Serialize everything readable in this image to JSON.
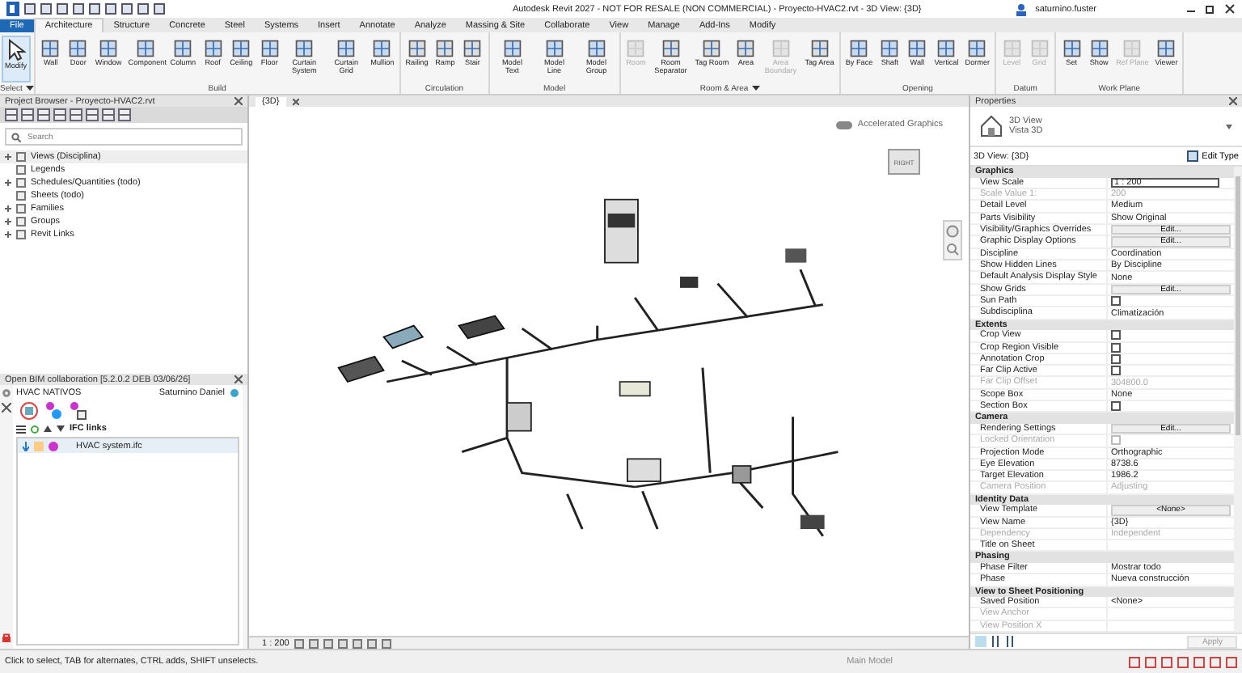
{
  "title_bar": {
    "title": "Autodesk Revit 2027 - NOT FOR RESALE (NON COMMERCIAL) - Proyecto-HVAC2.rvt - 3D View: {3D}",
    "user": "saturnino.fuster"
  },
  "ribbon_tabs": [
    {
      "label": "File",
      "kind": "file",
      "selected": false
    },
    {
      "label": "Architecture",
      "kind": "tab",
      "selected": true
    },
    {
      "label": "Structure",
      "kind": "tab",
      "selected": false
    },
    {
      "label": "Concrete",
      "kind": "tab",
      "selected": false
    },
    {
      "label": "Steel",
      "kind": "tab",
      "selected": false
    },
    {
      "label": "Systems",
      "kind": "tab",
      "selected": false
    },
    {
      "label": "Insert",
      "kind": "tab",
      "selected": false
    },
    {
      "label": "Annotate",
      "kind": "tab",
      "selected": false
    },
    {
      "label": "Analyze",
      "kind": "tab",
      "selected": false
    },
    {
      "label": "Massing & Site",
      "kind": "tab",
      "selected": false
    },
    {
      "label": "Collaborate",
      "kind": "tab",
      "selected": false
    },
    {
      "label": "View",
      "kind": "tab",
      "selected": false
    },
    {
      "label": "Manage",
      "kind": "tab",
      "selected": false
    },
    {
      "label": "Add-Ins",
      "kind": "tab",
      "selected": false
    },
    {
      "label": "Modify",
      "kind": "tab",
      "selected": false
    }
  ],
  "ribbon_groups": [
    {
      "label": "Select",
      "menu": true,
      "tools": [
        {
          "label": "Modify",
          "disabled": false,
          "selected": true
        }
      ]
    },
    {
      "label": "Build",
      "menu": false,
      "tools": [
        {
          "label": "Wall",
          "disabled": false,
          "selected": false
        },
        {
          "label": "Door",
          "disabled": false,
          "selected": false
        },
        {
          "label": "Window",
          "disabled": false,
          "selected": false
        },
        {
          "label": "Component",
          "disabled": false,
          "selected": false
        },
        {
          "label": "Column",
          "disabled": false,
          "selected": false
        },
        {
          "label": "Roof",
          "disabled": false,
          "selected": false
        },
        {
          "label": "Ceiling",
          "disabled": false,
          "selected": false
        },
        {
          "label": "Floor",
          "disabled": false,
          "selected": false
        },
        {
          "label": "Curtain System",
          "disabled": false,
          "selected": false
        },
        {
          "label": "Curtain Grid",
          "disabled": false,
          "selected": false
        },
        {
          "label": "Mullion",
          "disabled": false,
          "selected": false
        }
      ]
    },
    {
      "label": "Circulation",
      "menu": false,
      "tools": [
        {
          "label": "Railing",
          "disabled": false,
          "selected": false
        },
        {
          "label": "Ramp",
          "disabled": false,
          "selected": false
        },
        {
          "label": "Stair",
          "disabled": false,
          "selected": false
        }
      ]
    },
    {
      "label": "Model",
      "menu": false,
      "tools": [
        {
          "label": "Model Text",
          "disabled": false,
          "selected": false
        },
        {
          "label": "Model Line",
          "disabled": false,
          "selected": false
        },
        {
          "label": "Model Group",
          "disabled": false,
          "selected": false
        }
      ]
    },
    {
      "label": "Room & Area",
      "menu": true,
      "tools": [
        {
          "label": "Room",
          "disabled": true,
          "selected": false
        },
        {
          "label": "Room Separator",
          "disabled": false,
          "selected": false
        },
        {
          "label": "Tag Room",
          "disabled": false,
          "selected": false
        },
        {
          "label": "Area",
          "disabled": false,
          "selected": false
        },
        {
          "label": "Area Boundary",
          "disabled": true,
          "selected": false
        },
        {
          "label": "Tag Area",
          "disabled": false,
          "selected": false
        }
      ]
    },
    {
      "label": "Opening",
      "menu": false,
      "tools": [
        {
          "label": "By Face",
          "disabled": false,
          "selected": false
        },
        {
          "label": "Shaft",
          "disabled": false,
          "selected": false
        },
        {
          "label": "Wall",
          "disabled": false,
          "selected": false
        },
        {
          "label": "Vertical",
          "disabled": false,
          "selected": false
        },
        {
          "label": "Dormer",
          "disabled": false,
          "selected": false
        }
      ]
    },
    {
      "label": "Datum",
      "menu": false,
      "tools": [
        {
          "label": "Level",
          "disabled": true,
          "selected": false
        },
        {
          "label": "Grid",
          "disabled": true,
          "selected": false
        }
      ]
    },
    {
      "label": "Work Plane",
      "menu": false,
      "tools": [
        {
          "label": "Set",
          "disabled": false,
          "selected": false
        },
        {
          "label": "Show",
          "disabled": false,
          "selected": false
        },
        {
          "label": "Ref Plane",
          "disabled": true,
          "selected": false
        },
        {
          "label": "Viewer",
          "disabled": false,
          "selected": false
        }
      ]
    }
  ],
  "project_browser": {
    "title": "Project Browser - Proyecto-HVAC2.rvt",
    "search": {
      "placeholder": "Search"
    },
    "items": [
      {
        "label": "Views (Disciplina)",
        "expandable": true,
        "selected": true
      },
      {
        "label": "Legends",
        "expandable": false,
        "selected": false
      },
      {
        "label": "Schedules/Quantities (todo)",
        "expandable": true,
        "selected": false
      },
      {
        "label": "Sheets (todo)",
        "expandable": false,
        "selected": false
      },
      {
        "label": "Families",
        "expandable": true,
        "selected": false
      },
      {
        "label": "Groups",
        "expandable": true,
        "selected": false
      },
      {
        "label": "Revit Links",
        "expandable": true,
        "selected": false
      }
    ]
  },
  "openbim": {
    "title": "Open BIM collaboration [5.2.0.2 DEB 03/06/26]",
    "project": "HVAC NATIVOS",
    "user": "Saturnino Daniel",
    "toolbar_label": "IFC links",
    "files": [
      {
        "name": "HVAC system.ifc",
        "selected": true
      }
    ]
  },
  "view_tab": {
    "label": "{3D}"
  },
  "viewport": {
    "toggle_label": "Accelerated Graphics",
    "toggle_on": false,
    "cube_face": "RIGHT",
    "scale": "1 : 200"
  },
  "properties": {
    "title": "Properties",
    "type_name": "3D View",
    "type_sub": "Vista 3D",
    "instance": "3D View: {3D}",
    "edit_type": "Edit Type",
    "apply": "Apply",
    "sections": [
      {
        "title": "Graphics",
        "rows": [
          {
            "label": "View Scale",
            "kind": "input",
            "value": "1 : 200",
            "disabled": false
          },
          {
            "label": "Scale Value    1:",
            "kind": "text",
            "value": "200",
            "disabled": true
          },
          {
            "label": "Detail Level",
            "kind": "text",
            "value": "Medium",
            "disabled": false
          },
          {
            "label": "Parts Visibility",
            "kind": "text",
            "value": "Show Original",
            "disabled": false
          },
          {
            "label": "Visibility/Graphics Overrides",
            "kind": "button",
            "value": "Edit...",
            "disabled": false
          },
          {
            "label": "Graphic Display Options",
            "kind": "button",
            "value": "Edit...",
            "disabled": false
          },
          {
            "label": "Discipline",
            "kind": "text",
            "value": "Coordination",
            "disabled": false
          },
          {
            "label": "Show Hidden Lines",
            "kind": "text",
            "value": "By Discipline",
            "disabled": false
          },
          {
            "label": "Default Analysis Display Style",
            "kind": "text",
            "value": "None",
            "disabled": false
          },
          {
            "label": "Show Grids",
            "kind": "button",
            "value": "Edit...",
            "disabled": false
          },
          {
            "label": "Sun Path",
            "kind": "checkbox",
            "checked": false,
            "disabled": false
          },
          {
            "label": "Subdisciplina",
            "kind": "text",
            "value": "Climatización",
            "disabled": false
          }
        ]
      },
      {
        "title": "Extents",
        "rows": [
          {
            "label": "Crop View",
            "kind": "checkbox",
            "checked": false,
            "disabled": false
          },
          {
            "label": "Crop Region Visible",
            "kind": "checkbox",
            "checked": false,
            "disabled": false
          },
          {
            "label": "Annotation Crop",
            "kind": "checkbox",
            "checked": false,
            "disabled": false
          },
          {
            "label": "Far Clip Active",
            "kind": "checkbox",
            "checked": false,
            "disabled": false
          },
          {
            "label": "Far Clip Offset",
            "kind": "text",
            "value": "304800.0",
            "disabled": true
          },
          {
            "label": "Scope Box",
            "kind": "text",
            "value": "None",
            "disabled": false
          },
          {
            "label": "Section Box",
            "kind": "checkbox",
            "checked": false,
            "disabled": false
          }
        ]
      },
      {
        "title": "Camera",
        "rows": [
          {
            "label": "Rendering Settings",
            "kind": "button",
            "value": "Edit...",
            "disabled": false
          },
          {
            "label": "Locked Orientation",
            "kind": "checkbox",
            "checked": false,
            "disabled": true
          },
          {
            "label": "Projection Mode",
            "kind": "text",
            "value": "Orthographic",
            "disabled": false
          },
          {
            "label": "Eye Elevation",
            "kind": "text",
            "value": "8738.6",
            "disabled": false
          },
          {
            "label": "Target Elevation",
            "kind": "text",
            "value": "1986.2",
            "disabled": false
          },
          {
            "label": "Camera Position",
            "kind": "text",
            "value": "Adjusting",
            "disabled": true
          }
        ]
      },
      {
        "title": "Identity Data",
        "rows": [
          {
            "label": "View Template",
            "kind": "button",
            "value": "<None>",
            "disabled": false
          },
          {
            "label": "View Name",
            "kind": "text",
            "value": "{3D}",
            "disabled": false
          },
          {
            "label": "Dependency",
            "kind": "text",
            "value": "Independent",
            "disabled": true
          },
          {
            "label": "Title on Sheet",
            "kind": "text",
            "disabled": false
          }
        ]
      },
      {
        "title": "Phasing",
        "rows": [
          {
            "label": "Phase Filter",
            "kind": "text",
            "value": "Mostrar todo",
            "disabled": false
          },
          {
            "label": "Phase",
            "kind": "text",
            "value": "Nueva construcción",
            "disabled": false
          }
        ]
      },
      {
        "title": "View to Sheet Positioning",
        "rows": [
          {
            "label": "Saved Position",
            "kind": "text",
            "value": "<None>",
            "disabled": false
          },
          {
            "label": "View Anchor",
            "kind": "text",
            "disabled": true
          },
          {
            "label": "View Position X",
            "kind": "text",
            "disabled": true
          }
        ]
      }
    ]
  },
  "status_bar": {
    "hint": "Click to select, TAB for alternates, CTRL adds, SHIFT unselects.",
    "model": "Main Model"
  }
}
